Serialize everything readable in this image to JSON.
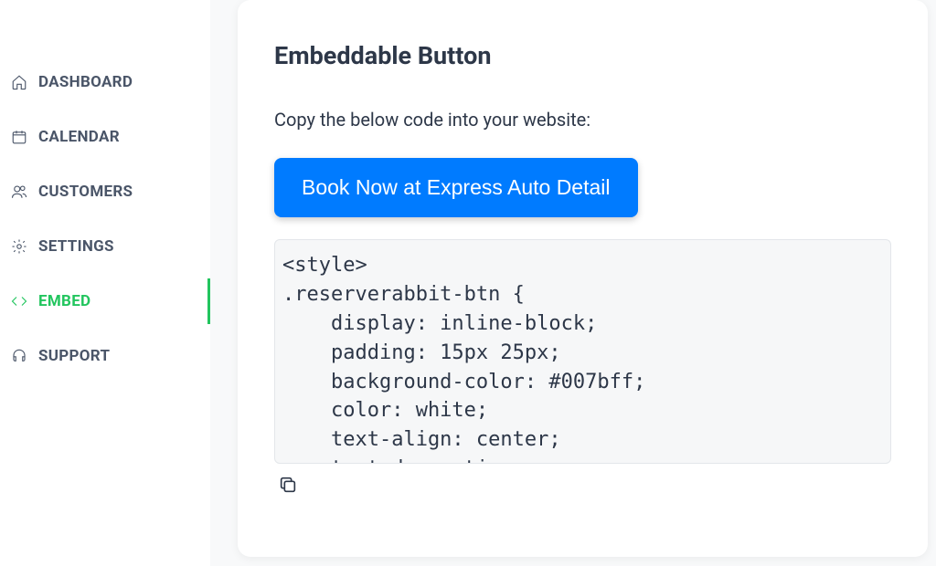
{
  "sidebar": {
    "items": [
      {
        "label": "Dashboard"
      },
      {
        "label": "Calendar"
      },
      {
        "label": "Customers"
      },
      {
        "label": "Settings"
      },
      {
        "label": "Embed"
      },
      {
        "label": "Support"
      }
    ]
  },
  "main": {
    "title": "Embeddable Button",
    "instruction": "Copy the below code into your website:",
    "preview_label": "Book Now at Express Auto Detail",
    "code": "<style>\n.reserverabbit-btn {\n    display: inline-block;\n    padding: 15px 25px;\n    background-color: #007bff;\n    color: white;\n    text-align: center;\n    text-decoration: none;"
  }
}
